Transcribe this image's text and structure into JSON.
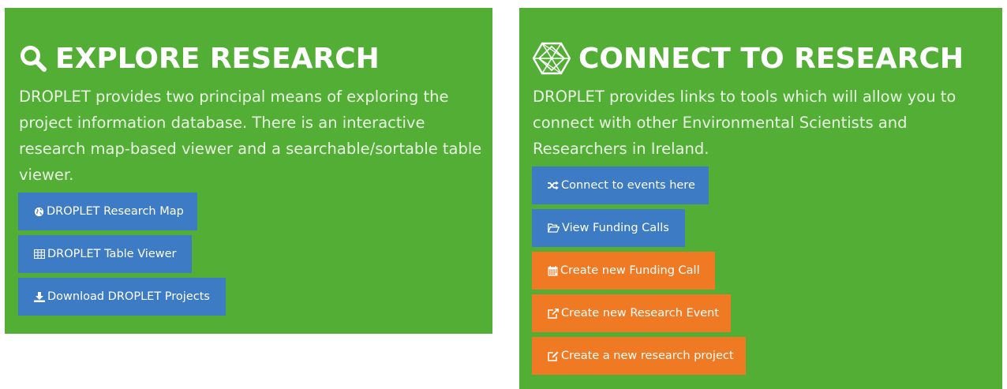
{
  "explore": {
    "title": "EXPLORE RESEARCH",
    "icon": "search-icon",
    "description": "DROPLET provides two principal means of exploring the project information database. There is an interactive research map-based viewer and a searchable/sortable table viewer.",
    "buttons": [
      {
        "label": "DROPLET Research Map",
        "icon": "globe-icon",
        "color": "#3d7cc5"
      },
      {
        "label": "DROPLET Table Viewer",
        "icon": "table-icon",
        "color": "#3d7cc5"
      },
      {
        "label": "Download DROPLET Projects",
        "icon": "download-icon",
        "color": "#3d7cc5"
      }
    ]
  },
  "connect": {
    "title": "CONNECT TO RESEARCH",
    "icon": "network-icon",
    "description": "DROPLET provides links to tools which will allow you to connect with other Environmental Scientists and Researchers in Ireland.",
    "buttons": [
      {
        "label": "Connect to events here",
        "icon": "shuffle-icon",
        "color": "#3d7cc5"
      },
      {
        "label": "View Funding Calls",
        "icon": "folder-open-icon",
        "color": "#3d7cc5"
      },
      {
        "label": "Create new Funding Call",
        "icon": "calendar-icon",
        "color": "#f07a23"
      },
      {
        "label": "Create new Research Event",
        "icon": "external-edit-icon",
        "color": "#f07a23"
      },
      {
        "label": "Create a new research project",
        "icon": "edit-icon",
        "color": "#f07a23"
      }
    ]
  },
  "colors": {
    "panel_green": "#53ae35",
    "button_blue": "#3d7cc5",
    "button_orange": "#f07a23"
  }
}
